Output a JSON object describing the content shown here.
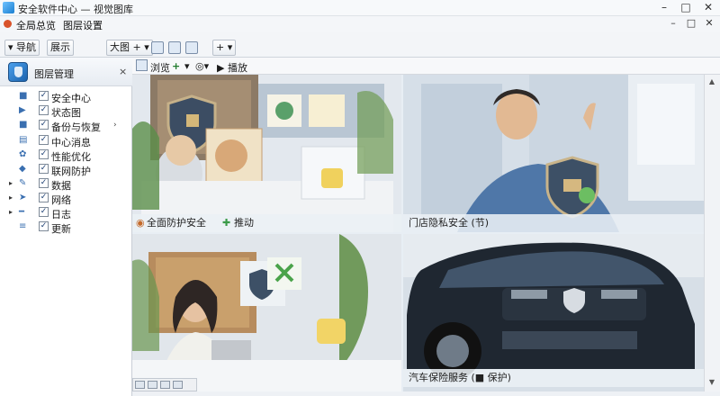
{
  "window": {
    "title": "安全软件中心 — 视觉图库",
    "menu_line": "全局总览  图层  设置",
    "controls": {
      "minimize": "–",
      "maximize": "□",
      "close": "✕"
    }
  },
  "menubar": {
    "first_label": "全局总览",
    "second_label": "图层设置",
    "doc_controls": {
      "minimize": "–",
      "restore": "□",
      "close": "✕"
    }
  },
  "toolbar": {
    "btn1": "▾ 导航",
    "btn2": "展示",
    "btn3": "大图 + ▾",
    "btn4": "+ ▾"
  },
  "left_panel": {
    "header": "图层管理",
    "close": "×",
    "layers": [
      {
        "label": "安全中心",
        "checked": "✓",
        "twisty": "",
        "arrow": "›",
        "icon": "■"
      },
      {
        "label": "状态图",
        "checked": "✓",
        "twisty": "",
        "arrow": "",
        "icon": "▶"
      },
      {
        "label": "备份与恢复",
        "checked": "✓",
        "twisty": "",
        "arrow": "›",
        "icon": "■"
      },
      {
        "label": "中心消息",
        "checked": "✓",
        "twisty": "",
        "arrow": "",
        "icon": "▤"
      },
      {
        "label": "性能优化",
        "checked": "✓",
        "twisty": "",
        "arrow": "",
        "icon": "✿"
      },
      {
        "label": "联网防护",
        "checked": "✓",
        "twisty": "",
        "arrow": "",
        "icon": "◆"
      },
      {
        "label": "数据",
        "checked": "✓",
        "twisty": "▸",
        "arrow": "",
        "icon": "✎"
      },
      {
        "label": "网络",
        "checked": "✓",
        "twisty": "▸",
        "arrow": "",
        "icon": "➤"
      },
      {
        "label": "日志",
        "checked": "✓",
        "twisty": "▸",
        "arrow": "",
        "icon": "━"
      },
      {
        "label": "更新",
        "checked": "✓",
        "twisty": "",
        "arrow": "",
        "icon": "≡"
      }
    ]
  },
  "subbar": {
    "label": "浏览",
    "play": "▶ 播放"
  },
  "tiles": [
    {
      "caption": "全面防护安全",
      "caption2": "推动"
    },
    {
      "caption": "门店隐私安全 (节)"
    },
    {
      "caption": ""
    },
    {
      "caption": "汽车保险服务 (■ 保护)"
    }
  ]
}
